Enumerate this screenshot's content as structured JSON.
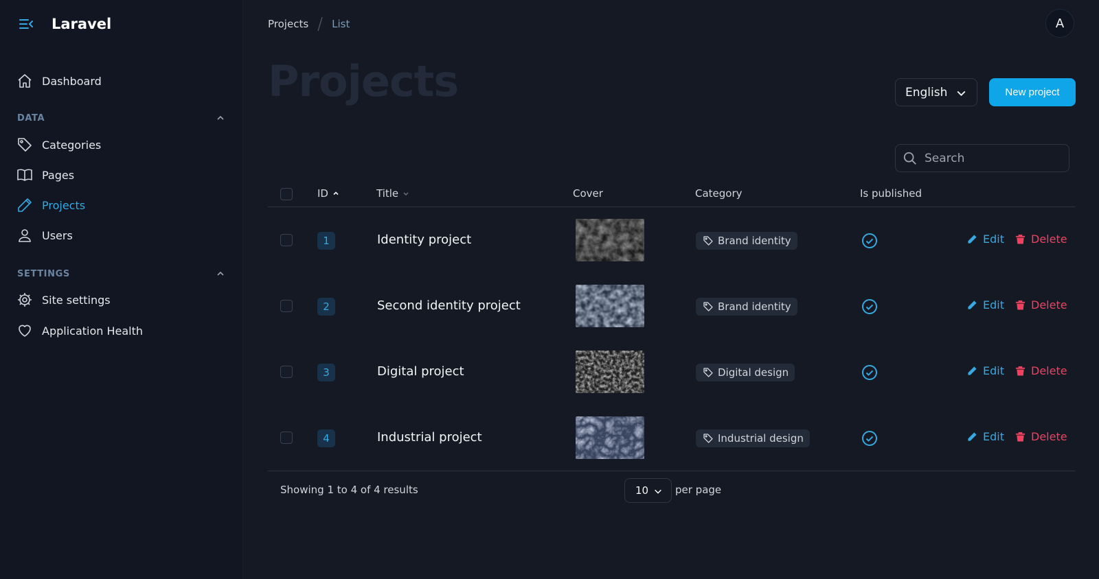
{
  "app": {
    "name": "Laravel"
  },
  "colors": {
    "accent": "#38a8e0",
    "primary_button": "#0ea5e9",
    "danger": "#f2415f",
    "background": "#141924",
    "sidebar": "#111622"
  },
  "sidebar": {
    "dashboard": {
      "label": "Dashboard",
      "icon": "home-icon"
    },
    "groups": [
      {
        "label": "DATA",
        "items": [
          {
            "label": "Categories",
            "icon": "tag-icon"
          },
          {
            "label": "Pages",
            "icon": "book-icon"
          },
          {
            "label": "Projects",
            "icon": "pencil-icon",
            "active": true
          },
          {
            "label": "Users",
            "icon": "user-icon"
          }
        ]
      },
      {
        "label": "SETTINGS",
        "items": [
          {
            "label": "Site settings",
            "icon": "gear-icon"
          },
          {
            "label": "Application Health",
            "icon": "heart-icon"
          }
        ]
      }
    ]
  },
  "breadcrumb": [
    "Projects",
    "List"
  ],
  "user": {
    "avatar_initial": "A"
  },
  "page": {
    "title": "Projects"
  },
  "actions": {
    "language": "English",
    "new_button": "New project"
  },
  "search": {
    "placeholder": "Search"
  },
  "table": {
    "headers": {
      "id": "ID",
      "title": "Title",
      "cover": "Cover",
      "category": "Category",
      "published": "Is published"
    },
    "rows": [
      {
        "id": "1",
        "title": "Identity project",
        "category": "Brand identity",
        "published": true,
        "cover": "dark-rocks"
      },
      {
        "id": "2",
        "title": "Second identity project",
        "category": "Brand identity",
        "published": true,
        "cover": "blue-stones"
      },
      {
        "id": "3",
        "title": "Digital project",
        "category": "Digital design",
        "published": true,
        "cover": "grey-texture"
      },
      {
        "id": "4",
        "title": "Industrial project",
        "category": "Industrial design",
        "published": true,
        "cover": "blue-crack"
      }
    ],
    "edit_label": "Edit",
    "delete_label": "Delete"
  },
  "pagination": {
    "showing": "Showing 1 to 4 of 4 results",
    "per_page_value": "10",
    "per_page_label": "per page"
  }
}
